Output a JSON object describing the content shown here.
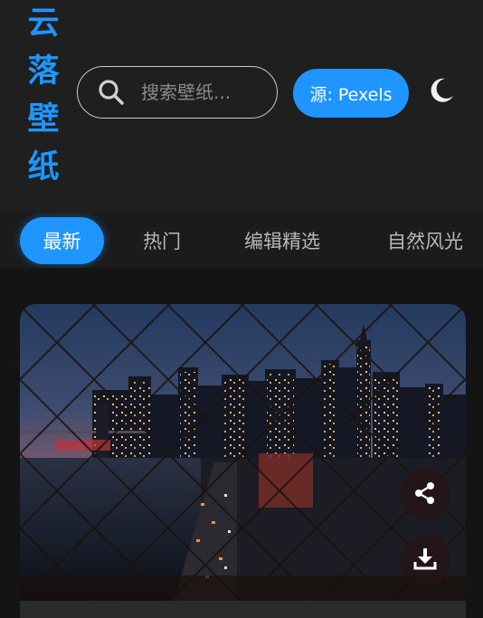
{
  "app": {
    "logo_chars": [
      "云",
      "落",
      "壁",
      "纸"
    ]
  },
  "search": {
    "placeholder": "搜索壁纸..."
  },
  "source_button": {
    "label": "源: Pexels"
  },
  "theme_toggle": {
    "icon": "moon-icon"
  },
  "tabs": [
    {
      "label": "最新",
      "active": true
    },
    {
      "label": "热门",
      "active": false
    },
    {
      "label": "编辑精选",
      "active": false
    },
    {
      "label": "自然风光",
      "active": false
    }
  ],
  "card": {
    "actions": {
      "share_icon": "share-icon",
      "download_icon": "download-icon"
    }
  },
  "colors": {
    "accent": "#1e95ff",
    "background": "#141414",
    "header": "#1f1f1f"
  }
}
